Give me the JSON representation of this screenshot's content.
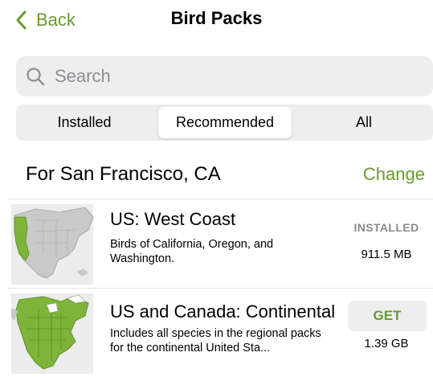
{
  "nav": {
    "back_label": "Back",
    "title": "Bird Packs"
  },
  "search": {
    "placeholder": "Search"
  },
  "tabs": [
    {
      "label": "Installed",
      "selected": false
    },
    {
      "label": "Recommended",
      "selected": true
    },
    {
      "label": "All",
      "selected": false
    }
  ],
  "location": {
    "label": "For San Francisco, CA",
    "change_label": "Change"
  },
  "packs": [
    {
      "name": "US: West Coast",
      "description": "Birds of California, Oregon, and Washington.",
      "status": "INSTALLED",
      "size": "911.5 MB",
      "thumbnail_icon": "west-coast-map"
    },
    {
      "name": "US and Canada: Continental",
      "description": "Includes all species in the regional packs for the continental United Sta...",
      "action_label": "GET",
      "size": "1.39 GB",
      "thumbnail_icon": "continental-map"
    }
  ],
  "colors": {
    "accent": "#6a9a2e",
    "map_highlight": "#7fb43a",
    "map_land": "#c9c9c9",
    "control_bg": "#eeeeef"
  }
}
